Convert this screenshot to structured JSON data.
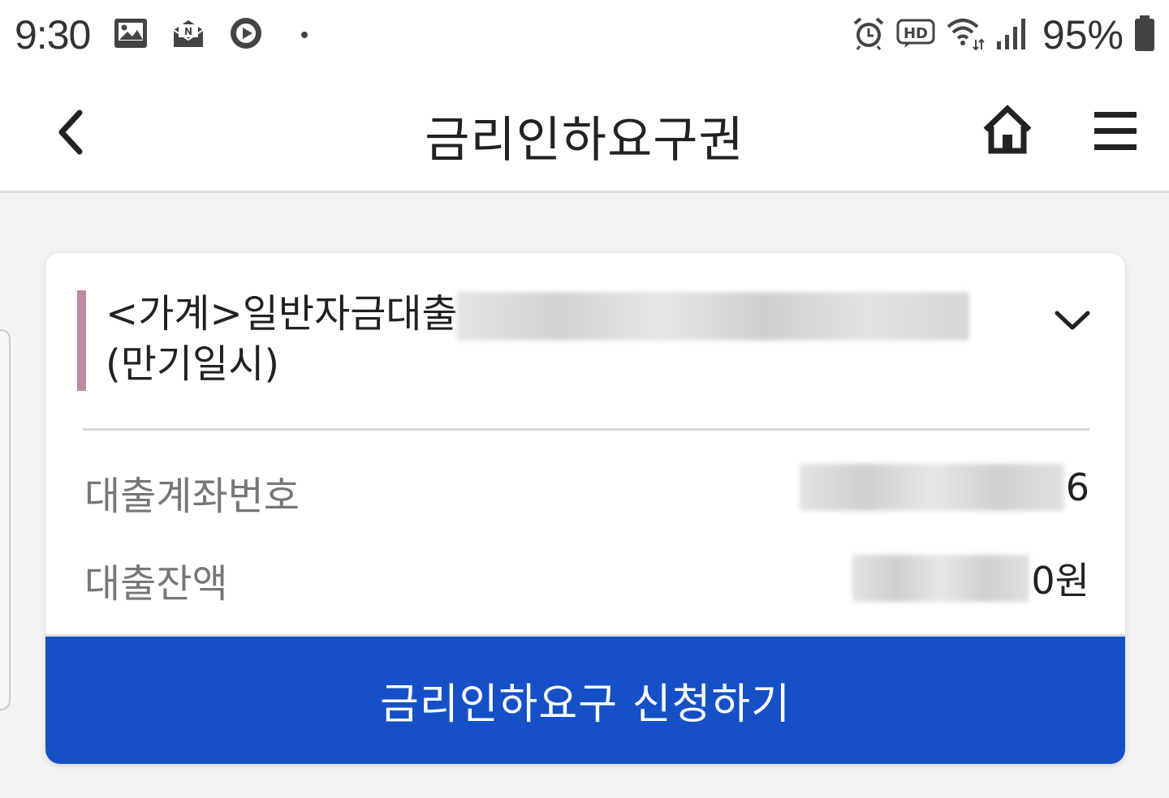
{
  "status_bar": {
    "time": "9:30",
    "battery": "95%",
    "icons_left": [
      "gallery-icon",
      "mail-icon",
      "play-icon"
    ],
    "icons_right": [
      "alarm-icon",
      "hd-icon",
      "wifi-icon",
      "signal-icon",
      "battery-icon"
    ]
  },
  "header": {
    "title": "금리인하요구권",
    "back_icon": "chevron-left-icon",
    "home_icon": "home-icon",
    "menu_icon": "hamburger-menu-icon"
  },
  "loan": {
    "title_line1": "<가계>일반자금대출",
    "title_line2": "(만기일시)",
    "account_label": "대출계좌번호",
    "account_value_visible": "6",
    "balance_label": "대출잔액",
    "balance_value_visible": "0원",
    "apply_button": "금리인하요구 신청하기"
  },
  "colors": {
    "accent": "#c08aa5",
    "button": "#1550c6",
    "background": "#f3f3f3"
  }
}
